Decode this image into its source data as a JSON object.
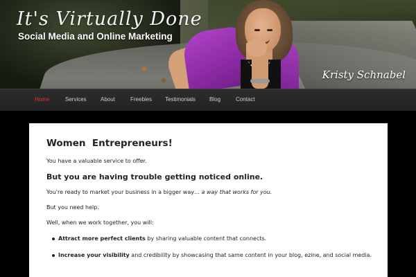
{
  "header": {
    "logo_script": "It's Virtually Done",
    "tagline": "Social Media and Online Marketing",
    "signature": "Kristy Schnabel"
  },
  "nav": {
    "items": [
      {
        "label": "Home",
        "active": true
      },
      {
        "label": "Services",
        "active": false
      },
      {
        "label": "About",
        "active": false
      },
      {
        "label": "Freebies",
        "active": false
      },
      {
        "label": "Testimonials",
        "active": false
      },
      {
        "label": "Blog",
        "active": false
      },
      {
        "label": "Contact",
        "active": false
      }
    ]
  },
  "content": {
    "heading": "Women  Entrepreneurs!",
    "p1": "You have a valuable service to offer.",
    "subheading": "But you are having trouble getting noticed online.",
    "p2_text": "You're ready to market your business in a bigger way… ",
    "p2_emphasis": "a way that works for you.",
    "p3": "But you need help.",
    "p4": "Well, when we work together, you will:",
    "bullets": [
      {
        "bold": "Attract more perfect clients",
        "rest": " by sharing valuable content that connects."
      },
      {
        "bold": "Increase your visibility",
        "rest": " and credibility by showcasing that same content in your blog, ezine, and social media."
      }
    ]
  },
  "colors": {
    "page_background": "#000000",
    "nav_background": "#262626",
    "nav_text": "#cfcfcf",
    "nav_active": "#e0342a",
    "vest_purple": "#a33fbf",
    "content_background": "#ffffff"
  }
}
